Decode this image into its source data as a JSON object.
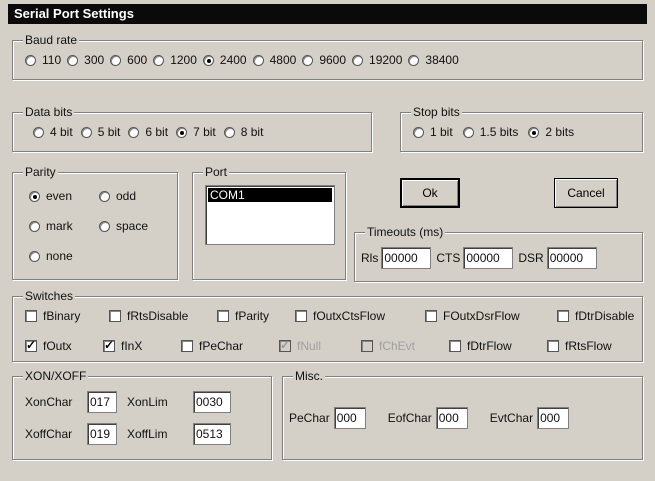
{
  "window": {
    "title": "Serial Port Settings"
  },
  "baud": {
    "label": "Baud rate",
    "options": [
      "110",
      "300",
      "600",
      "1200",
      "2400",
      "4800",
      "9600",
      "19200",
      "38400"
    ],
    "selected": "2400"
  },
  "databits": {
    "label": "Data bits",
    "options": [
      "4 bit",
      "5 bit",
      "6 bit",
      "7 bit",
      "8 bit"
    ],
    "selected": "7 bit"
  },
  "stopbits": {
    "label": "Stop bits",
    "options": [
      "1 bit",
      "1.5 bits",
      "2 bits"
    ],
    "selected": "2 bits"
  },
  "parity": {
    "label": "Parity",
    "options": [
      "even",
      "odd",
      "mark",
      "space",
      "none"
    ],
    "selected": "even"
  },
  "port": {
    "label": "Port",
    "items": [
      "COM1"
    ],
    "selected": "COM1"
  },
  "buttons": {
    "ok": "Ok",
    "cancel": "Cancel"
  },
  "timeouts": {
    "label": "Timeouts (ms)",
    "rls_label": "Rls",
    "rls_value": "00000",
    "cts_label": "CTS",
    "cts_value": "00000",
    "dsr_label": "DSR",
    "dsr_value": "00000"
  },
  "switches": {
    "label": "Switches",
    "row1": [
      {
        "label": "fBinary",
        "checked": false,
        "disabled": false
      },
      {
        "label": "fRtsDisable",
        "checked": false,
        "disabled": false
      },
      {
        "label": "fParity",
        "checked": false,
        "disabled": false
      },
      {
        "label": "fOutxCtsFlow",
        "checked": false,
        "disabled": false
      },
      {
        "label": "FOutxDsrFlow",
        "checked": false,
        "disabled": false
      },
      {
        "label": "fDtrDisable",
        "checked": false,
        "disabled": false
      }
    ],
    "row2": [
      {
        "label": "fOutx",
        "checked": true,
        "disabled": false
      },
      {
        "label": "fInX",
        "checked": true,
        "disabled": false
      },
      {
        "label": "fPeChar",
        "checked": false,
        "disabled": false
      },
      {
        "label": "fNull",
        "checked": true,
        "disabled": true
      },
      {
        "label": "fChEvt",
        "checked": false,
        "disabled": true
      },
      {
        "label": "fDtrFlow",
        "checked": false,
        "disabled": false
      },
      {
        "label": "fRtsFlow",
        "checked": false,
        "disabled": false
      }
    ]
  },
  "xonxoff": {
    "label": "XON/XOFF",
    "xonchar_label": "XonChar",
    "xonchar_value": "017",
    "xonlim_label": "XonLim",
    "xonlim_value": "0030",
    "xoffchar_label": "XoffChar",
    "xoffchar_value": "019",
    "xofflim_label": "XoffLim",
    "xofflim_value": "0513"
  },
  "misc": {
    "label": "Misc.",
    "pechar_label": "PeChar",
    "pechar_value": "000",
    "eofchar_label": "EofChar",
    "eofchar_value": "000",
    "evtchar_label": "EvtChar",
    "evtchar_value": "000"
  }
}
